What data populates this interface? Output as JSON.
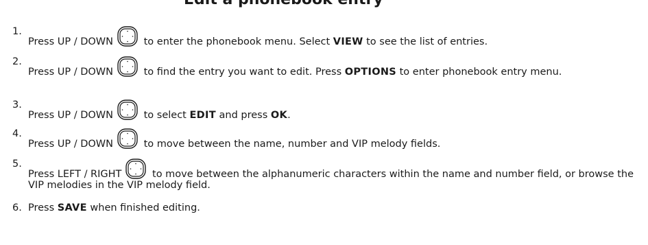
{
  "heading": "Edit a phonebook entry",
  "nav_icon_name": "navigation-key-icon",
  "steps": [
    {
      "number": "1.",
      "before_icon": "Press UP / DOWN",
      "text": [
        {
          "t": " to enter the phonebook menu. Select "
        },
        {
          "t": "VIEW",
          "b": true
        },
        {
          "t": " to see the list of entries."
        }
      ]
    },
    {
      "number": "2.",
      "before_icon": "Press UP / DOWN",
      "text": [
        {
          "t": " to find the entry you want to edit. Press "
        },
        {
          "t": "OPTIONS",
          "b": true
        },
        {
          "t": " to enter phonebook entry menu."
        }
      ]
    },
    {
      "number": "3.",
      "before_icon": "Press UP / DOWN",
      "text": [
        {
          "t": " to select "
        },
        {
          "t": "EDIT",
          "b": true
        },
        {
          "t": " and press "
        },
        {
          "t": "OK",
          "b": true
        },
        {
          "t": "."
        }
      ]
    },
    {
      "number": "4.",
      "before_icon": "Press UP / DOWN",
      "text": [
        {
          "t": " to move between the name, number and VIP melody fields."
        }
      ]
    },
    {
      "number": "5.",
      "before_icon": "Press LEFT / RIGHT",
      "text": [
        {
          "t": " to move between the alphanumeric characters within the name and number field, or browse the VIP melodies in the VIP melody field."
        }
      ]
    },
    {
      "number": "6.",
      "before_icon": "Press",
      "text": [
        {
          "t": " "
        },
        {
          "t": "SAVE",
          "b": true
        },
        {
          "t": " when finished editing."
        }
      ]
    }
  ]
}
